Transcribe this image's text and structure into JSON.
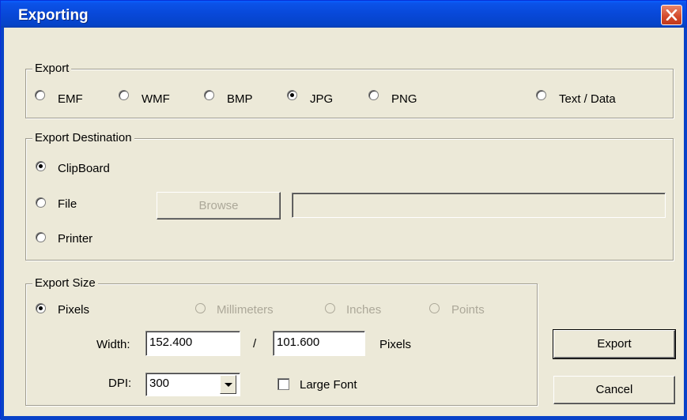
{
  "window": {
    "title": "Exporting"
  },
  "export_group": {
    "label": "Export",
    "options": [
      {
        "label": "EMF",
        "checked": false
      },
      {
        "label": "WMF",
        "checked": false
      },
      {
        "label": "BMP",
        "checked": false
      },
      {
        "label": "JPG",
        "checked": true
      },
      {
        "label": "PNG",
        "checked": false
      },
      {
        "label": "Text / Data",
        "checked": false
      }
    ]
  },
  "destination_group": {
    "label": "Export Destination",
    "options": [
      {
        "label": "ClipBoard",
        "checked": true
      },
      {
        "label": "File",
        "checked": false
      },
      {
        "label": "Printer",
        "checked": false
      }
    ],
    "browse_label": "Browse",
    "file_path": ""
  },
  "size_group": {
    "label": "Export Size",
    "units": [
      {
        "label": "Pixels",
        "checked": true,
        "enabled": true
      },
      {
        "label": "Millimeters",
        "checked": false,
        "enabled": false
      },
      {
        "label": "Inches",
        "checked": false,
        "enabled": false
      },
      {
        "label": "Points",
        "checked": false,
        "enabled": false
      }
    ],
    "width_label": "Width:",
    "width_value": "152.400",
    "separator": "/",
    "height_value": "101.600",
    "unit_label": "Pixels",
    "dpi_label": "DPI:",
    "dpi_value": "300",
    "large_font_label": "Large Font",
    "large_font_checked": false
  },
  "buttons": {
    "export": "Export",
    "cancel": "Cancel"
  },
  "colors": {
    "title_bar": "#0848d8",
    "close_button": "#d4492a",
    "dialog_bg": "#ece9d8"
  }
}
